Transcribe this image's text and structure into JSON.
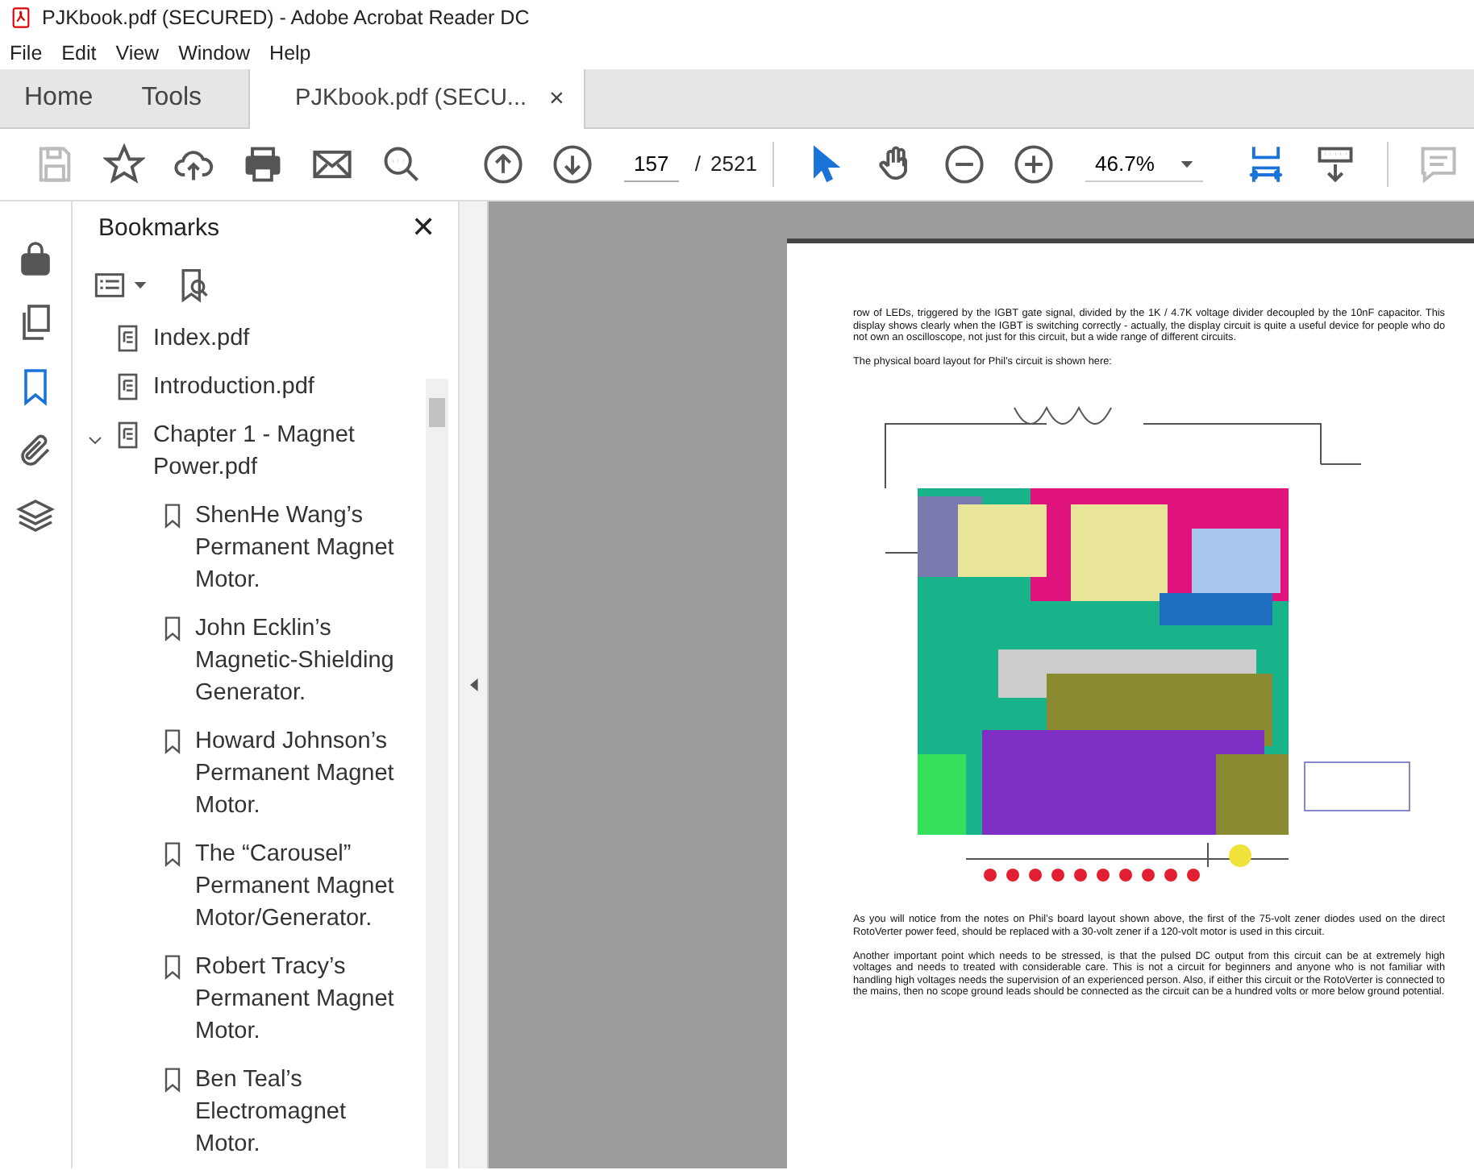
{
  "window": {
    "title": "PJKbook.pdf (SECURED) - Adobe Acrobat Reader DC"
  },
  "menu": [
    "File",
    "Edit",
    "View",
    "Window",
    "Help"
  ],
  "tabs": [
    {
      "label": "Home",
      "selected": false,
      "kind": "nav"
    },
    {
      "label": "Tools",
      "selected": false,
      "kind": "nav"
    },
    {
      "label": "PJKbook.pdf (SECU...",
      "selected": true,
      "kind": "doc",
      "close": "×"
    }
  ],
  "toolbar": {
    "page": "157",
    "page_sep": "/",
    "page_count": "2521",
    "zoom": "46.7%"
  },
  "bookmarks": {
    "title": "Bookmarks",
    "close": "✕",
    "items": [
      {
        "label": "Index.pdf",
        "kind": "file"
      },
      {
        "label": "Introduction.pdf",
        "kind": "file"
      },
      {
        "label": "Chapter 1 - Magnet Power.pdf",
        "kind": "file",
        "expanded": true,
        "children": [
          {
            "label": "ShenHe Wang’s Permanent Magnet Motor.",
            "kind": "mark"
          },
          {
            "label": "John Ecklin’s Magnetic-Shielding Generator.",
            "kind": "mark"
          },
          {
            "label": "Howard Johnson’s Permanent Magnet Motor.",
            "kind": "mark"
          },
          {
            "label": "The “Carousel” Permanent Magnet Motor/Generator.",
            "kind": "mark"
          },
          {
            "label": "Robert Tracy’s Permanent Magnet Motor.",
            "kind": "mark"
          },
          {
            "label": "Ben Teal’s Electromagnet Motor.",
            "kind": "mark"
          }
        ]
      }
    ]
  },
  "document": {
    "paragraphs": [
      "row of LEDs, triggered by the IGBT gate signal, divided by the 1K / 4.7K voltage divider decoupled by the 10nF capacitor.  This display shows clearly when the IGBT is switching correctly - actually, the display circuit is quite a useful device for people who do not own an oscilloscope, not just for this circuit, but a wide range of different circuits.",
      "The physical board layout for Phil’s circuit is shown here:",
      "As you will notice from the notes on Phil’s board layout shown above, the first of the 75-volt zener diodes used on the direct RotoVerter power feed, should be replaced with a 30-volt zener if a 120-volt motor is used in this circuit.",
      "Another important point which needs to be stressed, is that the pulsed DC output from this circuit can be at extremely high voltages and needs to treated with considerable care.  This is not a circuit for beginners and anyone who is not familiar with handling high voltages needs the supervision of an experienced person.  Also, if either this circuit or the RotoVerter is connected to the mains, then no scope ground leads should be connected as the circuit can be a hundred volts or more below ground potential."
    ]
  }
}
